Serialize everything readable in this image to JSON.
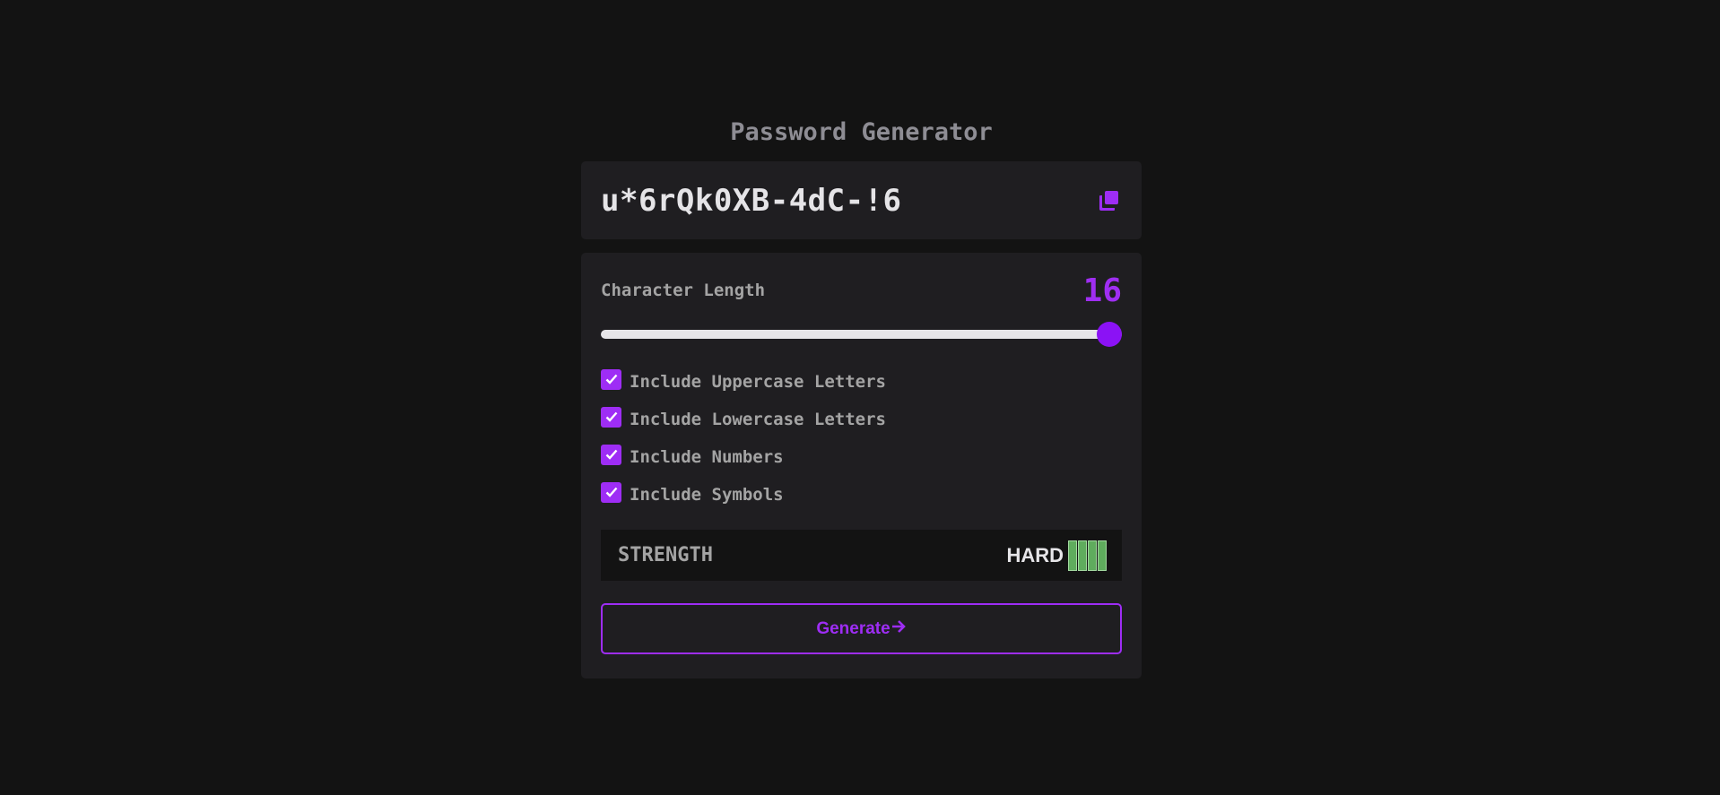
{
  "header": {
    "title": "Password Generator"
  },
  "output": {
    "password": "u*6rQk0XB-4dC-!6",
    "copy_icon": "copy-icon"
  },
  "settings": {
    "length_label": "Character Length",
    "length_value": "16",
    "slider_fraction": 1.0,
    "options": [
      {
        "label": "Include Uppercase Letters",
        "checked": true
      },
      {
        "label": "Include Lowercase Letters",
        "checked": true
      },
      {
        "label": "Include Numbers",
        "checked": true
      },
      {
        "label": "Include Symbols",
        "checked": true
      }
    ]
  },
  "strength": {
    "label": "STRENGTH",
    "level": "HARD",
    "bars_filled": 4,
    "bars_total": 4
  },
  "generate": {
    "label": "Generate",
    "icon": "arrow-right-icon"
  },
  "colors": {
    "background": "#131313",
    "panel": "#1f1e21",
    "accent": "#9e2df5",
    "strength_bar": "#5fac5d",
    "text_muted": "#a4a4a4",
    "text_bright": "#e5e4e7"
  }
}
